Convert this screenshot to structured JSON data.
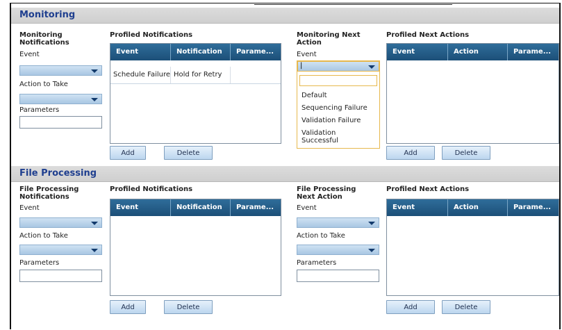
{
  "monitoring": {
    "title": "Monitoring",
    "notifications": {
      "title": "Monitoring Notifications",
      "event_label": "Event",
      "action_label": "Action to Take",
      "parameters_label": "Parameters"
    },
    "profiled_notifications": {
      "title": "Profiled Notifications",
      "columns": [
        "Event",
        "Notification",
        "Parame..."
      ],
      "rows": [
        [
          "Schedule Failure",
          "Hold for Retry",
          ""
        ]
      ],
      "add_label": "Add",
      "delete_label": "Delete"
    },
    "next_action": {
      "title": "Monitoring Next Action",
      "event_label": "Event",
      "dropdown_value": "|",
      "dropdown_options": [
        "",
        "Default",
        "Sequencing Failure",
        "Validation Failure",
        "Validation Successful"
      ]
    },
    "profiled_next_actions": {
      "title": "Profiled Next Actions",
      "columns": [
        "Event",
        "Action",
        "Parame..."
      ],
      "add_label": "Add",
      "delete_label": "Delete"
    }
  },
  "file_processing": {
    "title": "File Processing",
    "notifications": {
      "title": "File Processing Notifications",
      "event_label": "Event",
      "action_label": "Action to Take",
      "parameters_label": "Parameters"
    },
    "profiled_notifications": {
      "title": "Profiled Notifications",
      "columns": [
        "Event",
        "Notification",
        "Parame..."
      ],
      "add_label": "Add",
      "delete_label": "Delete"
    },
    "next_action": {
      "title": "File Processing Next Action",
      "event_label": "Event",
      "action_label": "Action to Take",
      "parameters_label": "Parameters"
    },
    "profiled_next_actions": {
      "title": "Profiled Next Actions",
      "columns": [
        "Event",
        "Action",
        "Parame..."
      ],
      "add_label": "Add",
      "delete_label": "Delete"
    }
  }
}
